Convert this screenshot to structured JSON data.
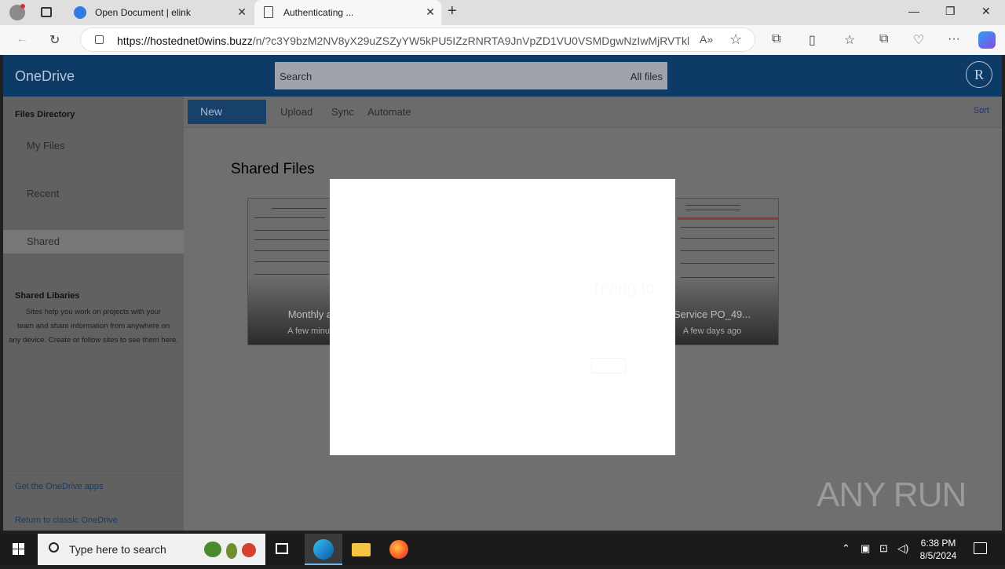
{
  "browser": {
    "tabs": [
      {
        "title": "Open Document | elink",
        "active": false
      },
      {
        "title": "Authenticating ...",
        "active": true
      }
    ],
    "url_host": "https://hostednet0wins.buzz",
    "url_path": "/n/?c3Y9bzM2NV8yX29uZSZyYW5kPU5IZzRNRTA9JnVpZD1VU0VSMDgwNzIwMjRVTklR..."
  },
  "onedrive": {
    "brand": "OneDrive",
    "search_placeholder": "Search",
    "search_scope": "All files",
    "avatar_initial": "R",
    "sidebar": {
      "heading": "Files Directory",
      "items": [
        "My Files",
        "Recent",
        "Shared"
      ],
      "selected": "Shared",
      "libraries_heading": "Shared Libaries",
      "libraries_desc_1": "Sites help you work on projects with your",
      "libraries_desc_2": "team and share information from    anywhere on",
      "libraries_desc_3": "any device. Create or follow    sites to see them here.",
      "link_apps": "Get the OneDrive apps",
      "link_classic": "Return to classic OneDrive"
    },
    "commands": {
      "new": "New",
      "upload": "Upload",
      "sync": "Sync",
      "automate": "Automate",
      "sort": "Sort"
    },
    "content_title": "Shared Files",
    "files": [
      {
        "name": "Monthly anali",
        "date": "A few minutes a"
      },
      {
        "name": "Service PO_49...",
        "date": "A few days ago"
      }
    ],
    "modal_ghost_text": "Trying to"
  },
  "watermark": "ANY RUN",
  "taskbar": {
    "search_placeholder": "Type here to search",
    "time": "6:38 PM",
    "date": "8/5/2024"
  }
}
